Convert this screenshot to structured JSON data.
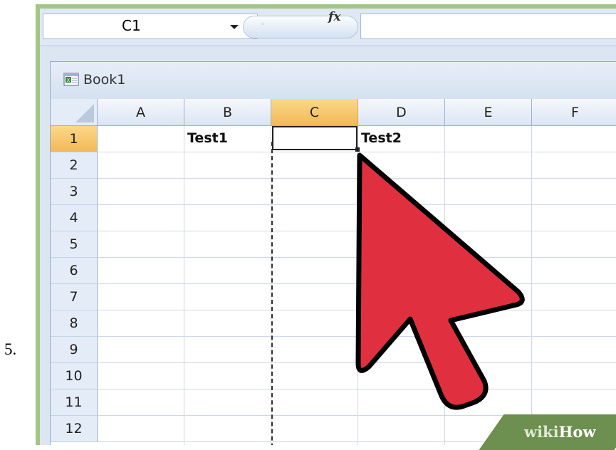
{
  "step_number": "5.",
  "formula_bar": {
    "name_box_value": "C1",
    "fx_label": "fx",
    "formula_value": ""
  },
  "workbook": {
    "title": "Book1"
  },
  "grid": {
    "columns": [
      "A",
      "B",
      "C",
      "D",
      "E",
      "F"
    ],
    "rows": [
      "1",
      "2",
      "3",
      "4",
      "5",
      "6",
      "7",
      "8",
      "9",
      "10",
      "11",
      "12"
    ],
    "selected_column": "C",
    "selected_row": "1",
    "cells": {
      "B1": "Test1",
      "C1": "",
      "D1": "Test2"
    }
  },
  "cursor": {
    "icon": "mouse-pointer-icon",
    "color": "#e03040"
  },
  "watermark": {
    "wiki": "wiki",
    "how": "How"
  },
  "colors": {
    "frame": "#a3c585",
    "selected_header": "#f2b956"
  }
}
